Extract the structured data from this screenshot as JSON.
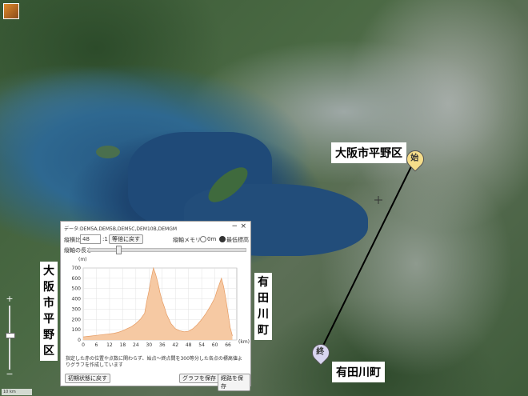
{
  "map": {
    "labels": {
      "start_place": "大阪市平野区",
      "end_place": "有田川町",
      "left_vertical_place": "大阪市平野区",
      "right_vertical_place": "有田川町"
    },
    "markers": {
      "start": "始",
      "end": "終"
    },
    "scale": "10 km",
    "zoom_in": "+",
    "zoom_out": "−"
  },
  "panel": {
    "data_source": "データ:DEM5A,DEM5B,DEM5C,DEM10B,DEMGM",
    "ratio_label": "縦横比",
    "ratio_value": "48",
    "ratio_suffix": ":1",
    "reset_ratio_btn": "等倍に戻す",
    "axis_memory_label": "縦軸メモリ",
    "option_zero": "0m",
    "option_min": "最低標高",
    "axis_length_label": "縦軸の長さ",
    "description": "指定した赤の位置や点数に関わらず、始点〜終点間を300等分した各点の標高値よりグラフを作成しています",
    "reset_btn": "初期状態に戻す",
    "save_graph_btn": "グラフを保存",
    "save_route_btn": "経路を保存",
    "close": "×",
    "minimize": "−"
  },
  "chart_data": {
    "type": "area",
    "title": "",
    "xlabel": "(km)",
    "ylabel": "(m)",
    "xlim": [
      0,
      70
    ],
    "ylim": [
      0,
      700
    ],
    "xticks": [
      0,
      6,
      12,
      18,
      24,
      30,
      36,
      42,
      48,
      54,
      60,
      66
    ],
    "yticks": [
      0,
      100,
      200,
      300,
      400,
      500,
      600,
      700
    ],
    "fill_color": "#f6c9a3",
    "line_color": "#e69b62",
    "x": [
      0,
      2,
      4,
      6,
      8,
      10,
      12,
      14,
      16,
      18,
      20,
      22,
      24,
      26,
      28,
      29,
      30,
      31,
      32,
      33,
      34,
      35,
      36,
      37,
      38,
      40,
      42,
      44,
      46,
      48,
      50,
      52,
      54,
      56,
      58,
      60,
      61,
      62,
      63,
      64,
      65,
      66,
      67,
      68
    ],
    "values": [
      30,
      35,
      40,
      45,
      50,
      55,
      60,
      65,
      75,
      90,
      110,
      130,
      160,
      200,
      260,
      380,
      480,
      600,
      700,
      640,
      560,
      460,
      380,
      320,
      250,
      160,
      110,
      90,
      80,
      85,
      110,
      150,
      200,
      260,
      330,
      410,
      480,
      540,
      600,
      520,
      400,
      260,
      120,
      40
    ]
  }
}
